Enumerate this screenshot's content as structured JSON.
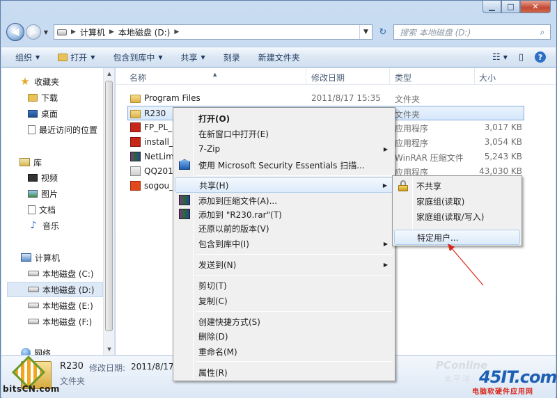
{
  "address": {
    "crumbs": [
      "计算机",
      "本地磁盘 (D:)"
    ]
  },
  "search": {
    "placeholder": "搜索 本地磁盘 (D:)"
  },
  "toolbar": {
    "organize": "组织",
    "open": "打开",
    "include_library": "包含到库中",
    "share": "共享",
    "burn": "刻录",
    "new_folder": "新建文件夹"
  },
  "nav": {
    "favorites": "收藏夹",
    "downloads": "下载",
    "desktop": "桌面",
    "recent": "最近访问的位置",
    "libraries": "库",
    "videos": "视频",
    "pictures": "图片",
    "documents": "文档",
    "music": "音乐",
    "computer": "计算机",
    "drive_c": "本地磁盘 (C:)",
    "drive_d": "本地磁盘 (D:)",
    "drive_e": "本地磁盘 (E:)",
    "drive_f": "本地磁盘 (F:)",
    "network": "网络"
  },
  "columns": {
    "name": "名称",
    "modified": "修改日期",
    "type": "类型",
    "size": "大小"
  },
  "files": [
    {
      "name": "Program Files",
      "modified": "2011/8/17 15:35",
      "type": "文件夹",
      "size": ""
    },
    {
      "name": "R230",
      "modified": "",
      "type": "文件夹",
      "size": ""
    },
    {
      "name": "FP_PL_P",
      "modified": "",
      "type": "应用程序",
      "size": "3,017 KB"
    },
    {
      "name": "install_f",
      "modified": "",
      "type": "应用程序",
      "size": "3,054 KB"
    },
    {
      "name": "NetLim",
      "modified": "",
      "type": "WinRAR 压缩文件",
      "size": "5,243 KB"
    },
    {
      "name": "QQ201",
      "modified": "",
      "type": "应用程序",
      "size": "43,030 KB"
    },
    {
      "name": "sogou_",
      "modified": "",
      "type": "",
      "size": ""
    }
  ],
  "details": {
    "name": "R230",
    "modified_label": "修改日期:",
    "modified_value": "2011/8/17",
    "type": "文件夹"
  },
  "context_menu": {
    "open": "打开(O)",
    "open_new_window": "在新窗口中打开(E)",
    "zip": "7-Zip",
    "mse_scan": "使用 Microsoft Security Essentials 扫描...",
    "share": "共享(H)",
    "add_archive": "添加到压缩文件(A)...",
    "add_rar": "添加到 \"R230.rar\"(T)",
    "restore": "还原以前的版本(V)",
    "include_library": "包含到库中(I)",
    "send_to": "发送到(N)",
    "cut": "剪切(T)",
    "copy": "复制(C)",
    "create_shortcut": "创建快捷方式(S)",
    "delete": "删除(D)",
    "rename": "重命名(M)",
    "properties": "属性(R)"
  },
  "share_submenu": {
    "no_share": "不共享",
    "homegroup_read": "家庭组(读取)",
    "homegroup_readwrite": "家庭组(读取/写入)",
    "specific_users": "特定用户..."
  },
  "watermarks": {
    "bits": "bitsCN.com",
    "pconline": "PConline",
    "pconline_cn": "太平洋",
    "site_45": "45IT.com",
    "site_45_cn": "电脑软硬件应用网"
  },
  "colors": {
    "annotation_arrow": "#d9271b",
    "selection": "#cce4fb",
    "menu_bg": "#f0f0f0"
  }
}
